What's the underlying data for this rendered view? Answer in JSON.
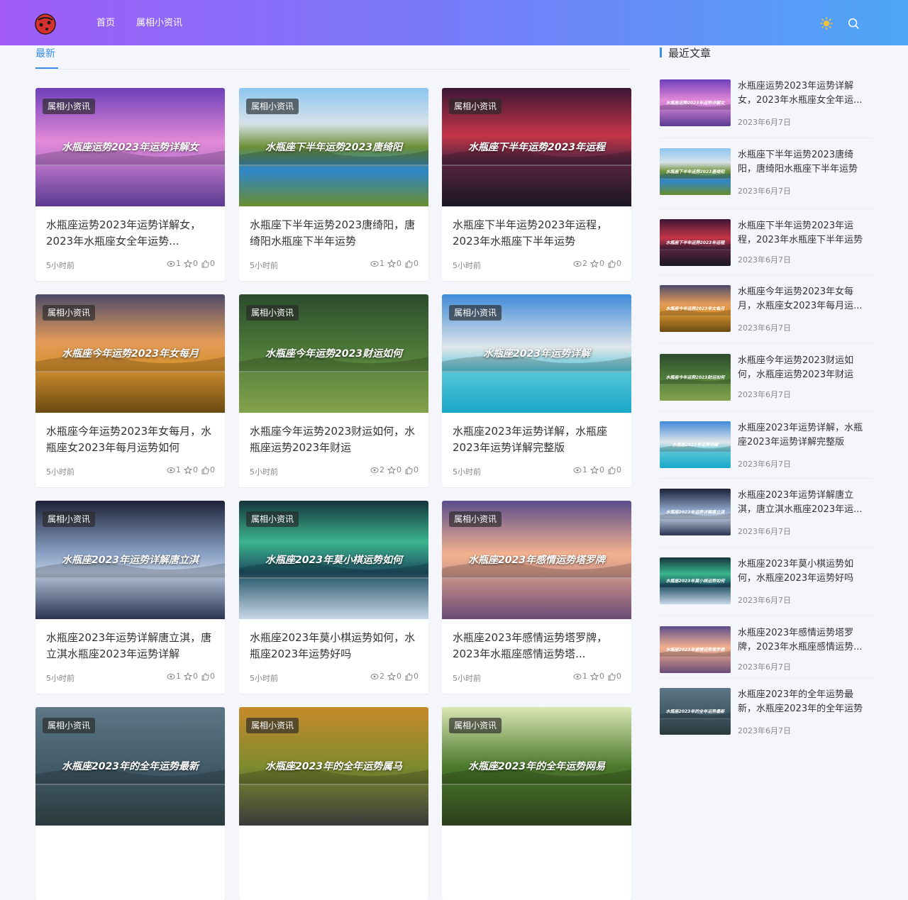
{
  "nav": {
    "home": "首页",
    "news": "属相小资讯"
  },
  "tab": {
    "latest": "最新"
  },
  "colors": {
    "accent": "#3a8de8",
    "header_start": "#a05cf5",
    "header_end": "#4ea6f7"
  },
  "cards": [
    {
      "badge": "属相小资讯",
      "thumb_text": "水瓶座运势2023年运势详解女",
      "title": "水瓶座运势2023年运势详解女，2023年水瓶座女全年运势...",
      "time": "5小时前",
      "views": "1",
      "stars": "0",
      "likes": "0"
    },
    {
      "badge": "属相小资讯",
      "thumb_text": "水瓶座下半年运势2023唐绮阳",
      "title": "水瓶座下半年运势2023唐绮阳，唐绮阳水瓶座下半年运势",
      "time": "5小时前",
      "views": "1",
      "stars": "0",
      "likes": "0"
    },
    {
      "badge": "属相小资讯",
      "thumb_text": "水瓶座下半年运势2023年运程",
      "title": "水瓶座下半年运势2023年运程，2023年水瓶座下半年运势",
      "time": "5小时前",
      "views": "2",
      "stars": "0",
      "likes": "0"
    },
    {
      "badge": "属相小资讯",
      "thumb_text": "水瓶座今年运势2023年女每月",
      "title": "水瓶座今年运势2023年女每月，水瓶座女2023年每月运势如何",
      "time": "5小时前",
      "views": "1",
      "stars": "0",
      "likes": "0"
    },
    {
      "badge": "属相小资讯",
      "thumb_text": "水瓶座今年运势2023财运如何",
      "title": "水瓶座今年运势2023财运如何，水瓶座运势2023年财运",
      "time": "5小时前",
      "views": "2",
      "stars": "0",
      "likes": "0"
    },
    {
      "badge": "属相小资讯",
      "thumb_text": "水瓶座2023年运势详解",
      "title": "水瓶座2023年运势详解，水瓶座2023年运势详解完整版",
      "time": "5小时前",
      "views": "1",
      "stars": "0",
      "likes": "0"
    },
    {
      "badge": "属相小资讯",
      "thumb_text": "水瓶座2023年运势详解唐立淇",
      "title": "水瓶座2023年运势详解唐立淇，唐立淇水瓶座2023年运势详解",
      "time": "5小时前",
      "views": "1",
      "stars": "0",
      "likes": "0"
    },
    {
      "badge": "属相小资讯",
      "thumb_text": "水瓶座2023年莫小棋运势如何",
      "title": "水瓶座2023年莫小棋运势如何，水瓶座2023年运势好吗",
      "time": "5小时前",
      "views": "2",
      "stars": "0",
      "likes": "0"
    },
    {
      "badge": "属相小资讯",
      "thumb_text": "水瓶座2023年感情运势塔罗牌",
      "title": "水瓶座2023年感情运势塔罗牌，2023年水瓶座感情运势塔...",
      "time": "5小时前",
      "views": "1",
      "stars": "0",
      "likes": "0"
    },
    {
      "badge": "属相小资讯",
      "thumb_text": "水瓶座2023年的全年运势最新",
      "title": "",
      "time": "",
      "views": "",
      "stars": "",
      "likes": ""
    },
    {
      "badge": "属相小资讯",
      "thumb_text": "水瓶座2023年的全年运势属马",
      "title": "",
      "time": "",
      "views": "",
      "stars": "",
      "likes": ""
    },
    {
      "badge": "属相小资讯",
      "thumb_text": "水瓶座2023年的全年运势网易",
      "title": "",
      "time": "",
      "views": "",
      "stars": "",
      "likes": ""
    }
  ],
  "sidebar": {
    "heading": "最近文章",
    "items": [
      {
        "thumb_text": "水瓶座运势2023年运势详解女",
        "title": "水瓶座运势2023年运势详解女，2023年水瓶座女全年运...",
        "date": "2023年6月7日"
      },
      {
        "thumb_text": "水瓶座下半年运势2023唐绮阳",
        "title": "水瓶座下半年运势2023唐绮阳，唐绮阳水瓶座下半年运势",
        "date": "2023年6月7日"
      },
      {
        "thumb_text": "水瓶座下半年运势2023年运程",
        "title": "水瓶座下半年运势2023年运程，2023年水瓶座下半年运势",
        "date": "2023年6月7日"
      },
      {
        "thumb_text": "水瓶座今年运势2023年女每月",
        "title": "水瓶座今年运势2023年女每月，水瓶座女2023年每月运...",
        "date": "2023年6月7日"
      },
      {
        "thumb_text": "水瓶座今年运势2023财运如何",
        "title": "水瓶座今年运势2023财运如何，水瓶座运势2023年财运",
        "date": "2023年6月7日"
      },
      {
        "thumb_text": "水瓶座2023年运势详解",
        "title": "水瓶座2023年运势详解，水瓶座2023年运势详解完整版",
        "date": "2023年6月7日"
      },
      {
        "thumb_text": "水瓶座2023年运势详解唐立淇",
        "title": "水瓶座2023年运势详解唐立淇，唐立淇水瓶座2023年运...",
        "date": "2023年6月7日"
      },
      {
        "thumb_text": "水瓶座2023年莫小棋运势如何",
        "title": "水瓶座2023年莫小棋运势如何，水瓶座2023年运势好吗",
        "date": "2023年6月7日"
      },
      {
        "thumb_text": "水瓶座2023年感情运势塔罗牌",
        "title": "水瓶座2023年感情运势塔罗牌，2023年水瓶座感情运势...",
        "date": "2023年6月7日"
      },
      {
        "thumb_text": "水瓶座2023年的全年运势最新",
        "title": "水瓶座2023年的全年运势最新，水瓶座2023年的全年运势",
        "date": "2023年6月7日"
      }
    ]
  }
}
